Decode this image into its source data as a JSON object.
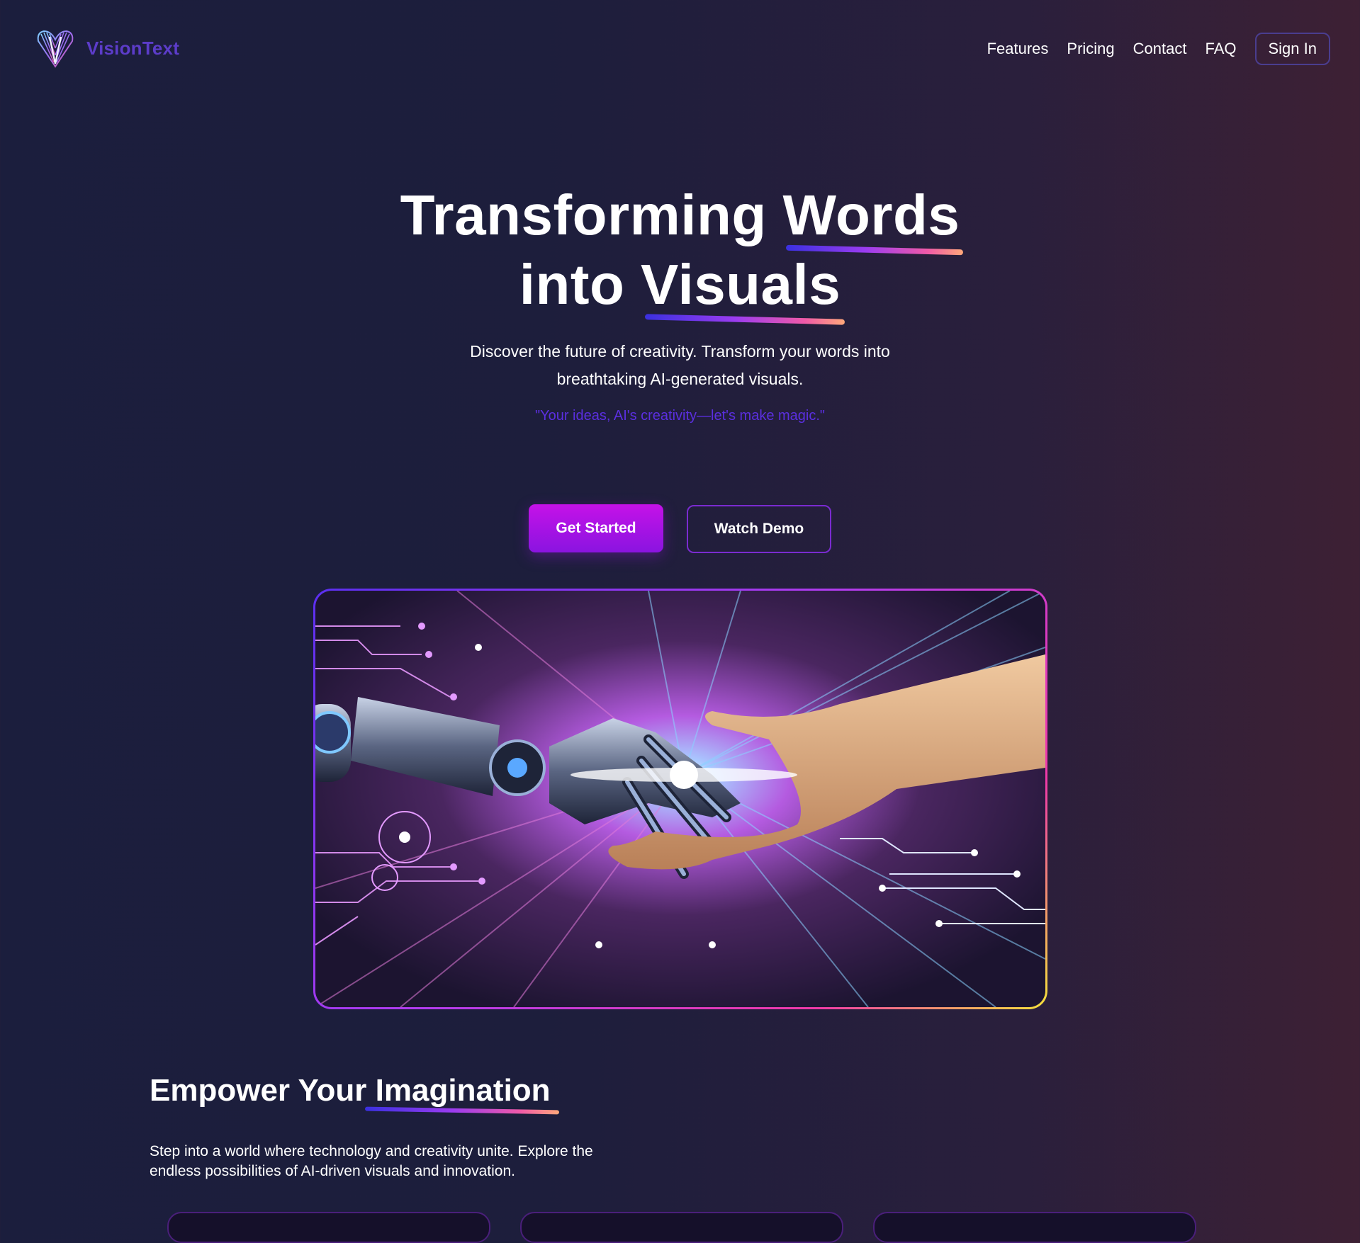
{
  "brand": {
    "name": "VisionText",
    "logo_icon": "heart-wing-logo-icon",
    "color": "#5c3cc9"
  },
  "nav": {
    "items": [
      {
        "label": "Features"
      },
      {
        "label": "Pricing"
      },
      {
        "label": "Contact"
      },
      {
        "label": "FAQ"
      }
    ],
    "sign_in_label": "Sign In"
  },
  "hero": {
    "title_line1_a": "Transforming ",
    "title_line1_b": "Words",
    "title_line2_a": "into ",
    "title_line2_b": "Visuals",
    "subtitle_line1": "Discover the future of creativity. Transform your words into",
    "subtitle_line2": "breathtaking AI-generated visuals.",
    "tagline": "\"Your ideas, AI's creativity—let's make magic.\"",
    "primary_cta": "Get Started",
    "secondary_cta": "Watch Demo",
    "image": "robot-human-handshake-image"
  },
  "section": {
    "title_a": "Empower Your ",
    "title_b": "Imagination",
    "desc_line1": "Step into a world where technology and creativity unite. Explore the",
    "desc_line2": "endless possibilities of AI-driven visuals and innovation."
  },
  "colors": {
    "accent_purple": "#8a14e0",
    "accent_magenta": "#c512e8",
    "tagline": "#5b2fe0",
    "underline_gradient": [
      "#3a30e0",
      "#9b3cf0",
      "#f05aa8",
      "#ffa87a"
    ]
  }
}
